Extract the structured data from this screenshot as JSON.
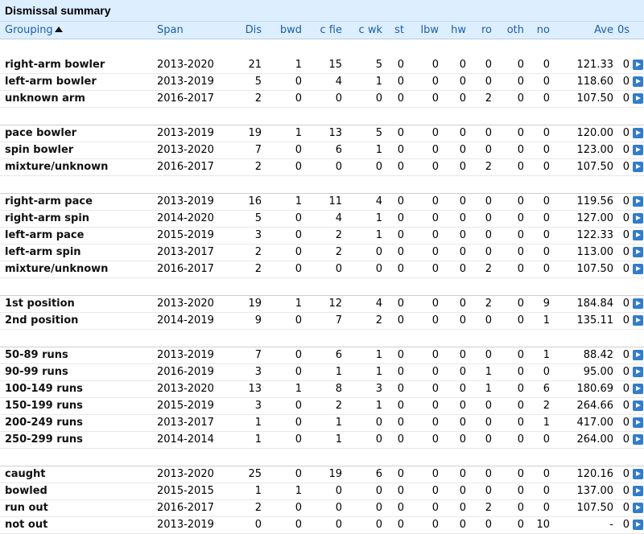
{
  "title": "Dismissal summary",
  "headers": [
    "Grouping",
    "Span",
    "Dis",
    "bwd",
    "c fie",
    "c wk",
    "st",
    "lbw",
    "hw",
    "ro",
    "oth",
    "no",
    "Ave",
    "0s"
  ],
  "groups": [
    [
      [
        "right-arm bowler",
        "2013-2020",
        "21",
        "1",
        "15",
        "5",
        "0",
        "0",
        "0",
        "0",
        "0",
        "0",
        "121.33",
        "0"
      ],
      [
        "left-arm bowler",
        "2013-2019",
        "5",
        "0",
        "4",
        "1",
        "0",
        "0",
        "0",
        "0",
        "0",
        "0",
        "118.60",
        "0"
      ],
      [
        "unknown arm",
        "2016-2017",
        "2",
        "0",
        "0",
        "0",
        "0",
        "0",
        "0",
        "2",
        "0",
        "0",
        "107.50",
        "0"
      ]
    ],
    [
      [
        "pace bowler",
        "2013-2019",
        "19",
        "1",
        "13",
        "5",
        "0",
        "0",
        "0",
        "0",
        "0",
        "0",
        "120.00",
        "0"
      ],
      [
        "spin bowler",
        "2013-2020",
        "7",
        "0",
        "6",
        "1",
        "0",
        "0",
        "0",
        "0",
        "0",
        "0",
        "123.00",
        "0"
      ],
      [
        "mixture/unknown",
        "2016-2017",
        "2",
        "0",
        "0",
        "0",
        "0",
        "0",
        "0",
        "2",
        "0",
        "0",
        "107.50",
        "0"
      ]
    ],
    [
      [
        "right-arm pace",
        "2013-2019",
        "16",
        "1",
        "11",
        "4",
        "0",
        "0",
        "0",
        "0",
        "0",
        "0",
        "119.56",
        "0"
      ],
      [
        "right-arm spin",
        "2014-2020",
        "5",
        "0",
        "4",
        "1",
        "0",
        "0",
        "0",
        "0",
        "0",
        "0",
        "127.00",
        "0"
      ],
      [
        "left-arm pace",
        "2015-2019",
        "3",
        "0",
        "2",
        "1",
        "0",
        "0",
        "0",
        "0",
        "0",
        "0",
        "122.33",
        "0"
      ],
      [
        "left-arm spin",
        "2013-2017",
        "2",
        "0",
        "2",
        "0",
        "0",
        "0",
        "0",
        "0",
        "0",
        "0",
        "113.00",
        "0"
      ],
      [
        "mixture/unknown",
        "2016-2017",
        "2",
        "0",
        "0",
        "0",
        "0",
        "0",
        "0",
        "2",
        "0",
        "0",
        "107.50",
        "0"
      ]
    ],
    [
      [
        "1st position",
        "2013-2020",
        "19",
        "1",
        "12",
        "4",
        "0",
        "0",
        "0",
        "2",
        "0",
        "9",
        "184.84",
        "0"
      ],
      [
        "2nd position",
        "2014-2019",
        "9",
        "0",
        "7",
        "2",
        "0",
        "0",
        "0",
        "0",
        "0",
        "1",
        "135.11",
        "0"
      ]
    ],
    [
      [
        "50-89 runs",
        "2013-2019",
        "7",
        "0",
        "6",
        "1",
        "0",
        "0",
        "0",
        "0",
        "0",
        "1",
        "88.42",
        "0"
      ],
      [
        "90-99 runs",
        "2016-2019",
        "3",
        "0",
        "1",
        "1",
        "0",
        "0",
        "0",
        "1",
        "0",
        "0",
        "95.00",
        "0"
      ],
      [
        "100-149 runs",
        "2013-2020",
        "13",
        "1",
        "8",
        "3",
        "0",
        "0",
        "0",
        "1",
        "0",
        "6",
        "180.69",
        "0"
      ],
      [
        "150-199 runs",
        "2015-2019",
        "3",
        "0",
        "2",
        "1",
        "0",
        "0",
        "0",
        "0",
        "0",
        "2",
        "264.66",
        "0"
      ],
      [
        "200-249 runs",
        "2013-2017",
        "1",
        "0",
        "1",
        "0",
        "0",
        "0",
        "0",
        "0",
        "0",
        "1",
        "417.00",
        "0"
      ],
      [
        "250-299 runs",
        "2014-2014",
        "1",
        "0",
        "1",
        "0",
        "0",
        "0",
        "0",
        "0",
        "0",
        "0",
        "264.00",
        "0"
      ]
    ],
    [
      [
        "caught",
        "2013-2020",
        "25",
        "0",
        "19",
        "6",
        "0",
        "0",
        "0",
        "0",
        "0",
        "0",
        "120.16",
        "0"
      ],
      [
        "bowled",
        "2015-2015",
        "1",
        "1",
        "0",
        "0",
        "0",
        "0",
        "0",
        "0",
        "0",
        "0",
        "137.00",
        "0"
      ],
      [
        "run out",
        "2016-2017",
        "2",
        "0",
        "0",
        "0",
        "0",
        "0",
        "0",
        "2",
        "0",
        "0",
        "107.50",
        "0"
      ],
      [
        "not out",
        "2013-2019",
        "0",
        "0",
        "0",
        "0",
        "0",
        "0",
        "0",
        "0",
        "0",
        "10",
        "-",
        "0"
      ]
    ]
  ],
  "icons": {
    "sort": "sort-ascending-icon",
    "row_link": "play-arrow-icon"
  },
  "colors": {
    "header_bg": "#ddeeff",
    "header_text": "#1a5fa8",
    "arrow": "#2e7dd1"
  }
}
